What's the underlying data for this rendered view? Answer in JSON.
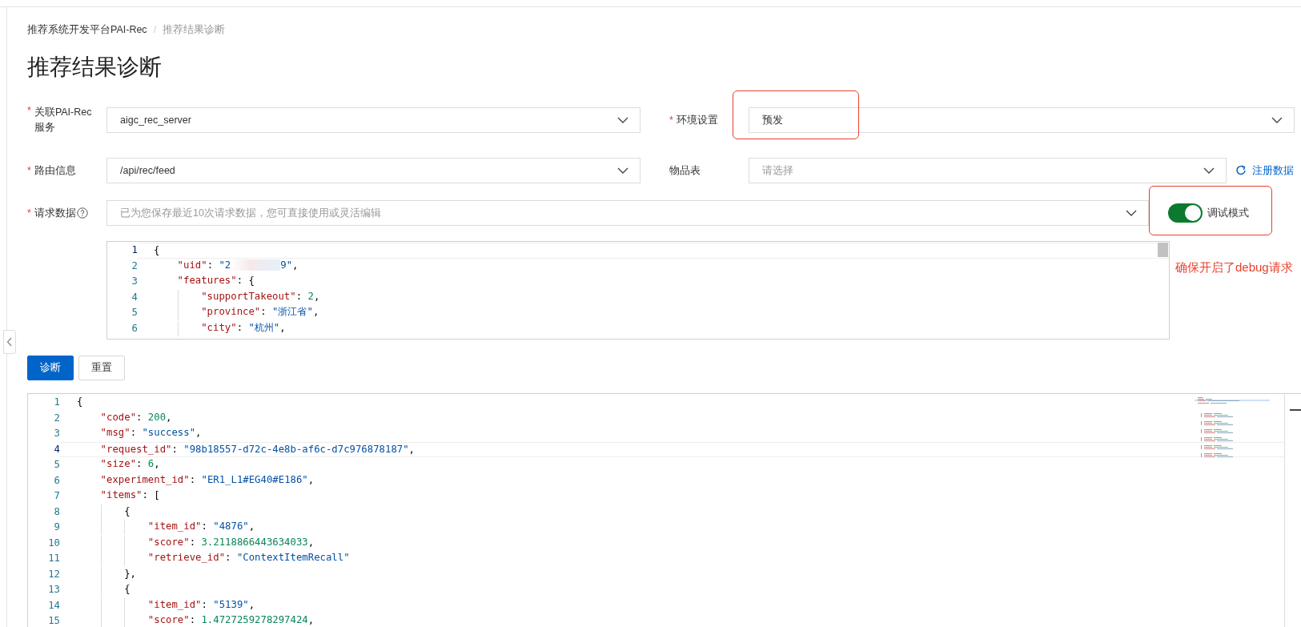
{
  "breadcrumb": [
    {
      "label": "推荐系统开发平台PAI-Rec",
      "current": false
    },
    {
      "label": "推荐结果诊断",
      "current": true
    }
  ],
  "breadcrumb_separator": "/",
  "title": "推荐结果诊断",
  "required_mark": "*",
  "form": {
    "service": {
      "label": "关联PAI-Rec服务",
      "required": true,
      "value": "aigc_rec_server"
    },
    "environment": {
      "label": "环境设置",
      "required": true,
      "value": "预发"
    },
    "route": {
      "label": "路由信息",
      "required": true,
      "value": "/api/rec/feed"
    },
    "item_table": {
      "label": "物品表",
      "required": false,
      "placeholder": "请选择",
      "link": "注册数据"
    },
    "request_data": {
      "label": "请求数据",
      "required": true,
      "placeholder": "已为您保存最近10次请求数据，您可直接使用或灵活编辑"
    },
    "debug_mode": {
      "label": "调试模式",
      "on": true
    }
  },
  "annotation": "确保开启了debug请求",
  "request_editor": {
    "lines": [
      {
        "n": "1",
        "current": true,
        "tokens": [
          {
            "kind": "punct",
            "text": "{"
          }
        ]
      },
      {
        "n": "2",
        "current": false,
        "tokens": [
          {
            "kind": "indent"
          },
          {
            "kind": "key",
            "text": "\"uid\""
          },
          {
            "kind": "punct",
            "text": ": "
          },
          {
            "kind": "str",
            "text": "\"2"
          },
          {
            "kind": "redacted"
          },
          {
            "kind": "str",
            "text": "9\""
          },
          {
            "kind": "punct",
            "text": ","
          }
        ]
      },
      {
        "n": "3",
        "current": false,
        "tokens": [
          {
            "kind": "indent"
          },
          {
            "kind": "key",
            "text": "\"features\""
          },
          {
            "kind": "punct",
            "text": ": {"
          }
        ]
      },
      {
        "n": "4",
        "current": false,
        "tokens": [
          {
            "kind": "indent"
          },
          {
            "kind": "indent"
          },
          {
            "kind": "key",
            "text": "\"supportTakeout\""
          },
          {
            "kind": "punct",
            "text": ": "
          },
          {
            "kind": "num",
            "text": "2"
          },
          {
            "kind": "punct",
            "text": ","
          }
        ]
      },
      {
        "n": "5",
        "current": false,
        "tokens": [
          {
            "kind": "indent"
          },
          {
            "kind": "indent"
          },
          {
            "kind": "key",
            "text": "\"province\""
          },
          {
            "kind": "punct",
            "text": ": "
          },
          {
            "kind": "str",
            "text": "\"浙江省\""
          },
          {
            "kind": "punct",
            "text": ","
          }
        ]
      },
      {
        "n": "6",
        "current": false,
        "tokens": [
          {
            "kind": "indent"
          },
          {
            "kind": "indent"
          },
          {
            "kind": "key",
            "text": "\"city\""
          },
          {
            "kind": "punct",
            "text": ": "
          },
          {
            "kind": "str",
            "text": "\"杭州\""
          },
          {
            "kind": "punct",
            "text": ","
          }
        ]
      }
    ]
  },
  "buttons": [
    {
      "label": "诊断",
      "kind": "primary"
    },
    {
      "label": "重置",
      "kind": "default"
    }
  ],
  "result_editor": {
    "lines": [
      {
        "n": "1",
        "current": false,
        "tokens": [
          {
            "kind": "punct",
            "text": "{"
          }
        ]
      },
      {
        "n": "2",
        "current": false,
        "tokens": [
          {
            "kind": "indent"
          },
          {
            "kind": "key",
            "text": "\"code\""
          },
          {
            "kind": "punct",
            "text": ": "
          },
          {
            "kind": "num",
            "text": "200"
          },
          {
            "kind": "punct",
            "text": ","
          }
        ]
      },
      {
        "n": "3",
        "current": false,
        "tokens": [
          {
            "kind": "indent"
          },
          {
            "kind": "key",
            "text": "\"msg\""
          },
          {
            "kind": "punct",
            "text": ": "
          },
          {
            "kind": "str",
            "text": "\"success\""
          },
          {
            "kind": "punct",
            "text": ","
          }
        ]
      },
      {
        "n": "4",
        "current": true,
        "tokens": [
          {
            "kind": "indent"
          },
          {
            "kind": "key",
            "text": "\"request_id\""
          },
          {
            "kind": "punct",
            "text": ": "
          },
          {
            "kind": "str",
            "text": "\"98b18557-d72c-4e8b-af6c-d7c976878187\""
          },
          {
            "kind": "punct",
            "text": ","
          }
        ]
      },
      {
        "n": "5",
        "current": false,
        "tokens": [
          {
            "kind": "indent"
          },
          {
            "kind": "key",
            "text": "\"size\""
          },
          {
            "kind": "punct",
            "text": ": "
          },
          {
            "kind": "num",
            "text": "6"
          },
          {
            "kind": "punct",
            "text": ","
          }
        ]
      },
      {
        "n": "6",
        "current": false,
        "tokens": [
          {
            "kind": "indent"
          },
          {
            "kind": "key",
            "text": "\"experiment_id\""
          },
          {
            "kind": "punct",
            "text": ": "
          },
          {
            "kind": "str",
            "text": "\"ER1_L1#EG40#E186\""
          },
          {
            "kind": "punct",
            "text": ","
          }
        ]
      },
      {
        "n": "7",
        "current": false,
        "tokens": [
          {
            "kind": "indent"
          },
          {
            "kind": "key",
            "text": "\"items\""
          },
          {
            "kind": "punct",
            "text": ": ["
          }
        ]
      },
      {
        "n": "8",
        "current": false,
        "tokens": [
          {
            "kind": "indent"
          },
          {
            "kind": "indent"
          },
          {
            "kind": "punct",
            "text": "{"
          }
        ]
      },
      {
        "n": "9",
        "current": false,
        "tokens": [
          {
            "kind": "indent"
          },
          {
            "kind": "indent"
          },
          {
            "kind": "indent"
          },
          {
            "kind": "key",
            "text": "\"item_id\""
          },
          {
            "kind": "punct",
            "text": ": "
          },
          {
            "kind": "str",
            "text": "\"4876\""
          },
          {
            "kind": "punct",
            "text": ","
          }
        ]
      },
      {
        "n": "10",
        "current": false,
        "tokens": [
          {
            "kind": "indent"
          },
          {
            "kind": "indent"
          },
          {
            "kind": "indent"
          },
          {
            "kind": "key",
            "text": "\"score\""
          },
          {
            "kind": "punct",
            "text": ": "
          },
          {
            "kind": "num",
            "text": "3.2118866443634033"
          },
          {
            "kind": "punct",
            "text": ","
          }
        ]
      },
      {
        "n": "11",
        "current": false,
        "tokens": [
          {
            "kind": "indent"
          },
          {
            "kind": "indent"
          },
          {
            "kind": "indent"
          },
          {
            "kind": "key",
            "text": "\"retrieve_id\""
          },
          {
            "kind": "punct",
            "text": ": "
          },
          {
            "kind": "str",
            "text": "\"ContextItemRecall\""
          }
        ]
      },
      {
        "n": "12",
        "current": false,
        "tokens": [
          {
            "kind": "indent"
          },
          {
            "kind": "indent"
          },
          {
            "kind": "punct",
            "text": "},"
          }
        ]
      },
      {
        "n": "13",
        "current": false,
        "tokens": [
          {
            "kind": "indent"
          },
          {
            "kind": "indent"
          },
          {
            "kind": "punct",
            "text": "{"
          }
        ]
      },
      {
        "n": "14",
        "current": false,
        "tokens": [
          {
            "kind": "indent"
          },
          {
            "kind": "indent"
          },
          {
            "kind": "indent"
          },
          {
            "kind": "key",
            "text": "\"item_id\""
          },
          {
            "kind": "punct",
            "text": ": "
          },
          {
            "kind": "str",
            "text": "\"5139\""
          },
          {
            "kind": "punct",
            "text": ","
          }
        ]
      },
      {
        "n": "15",
        "current": false,
        "tokens": [
          {
            "kind": "indent"
          },
          {
            "kind": "indent"
          },
          {
            "kind": "indent"
          },
          {
            "kind": "key",
            "text": "\"score\""
          },
          {
            "kind": "punct",
            "text": ": "
          },
          {
            "kind": "num",
            "text": "1.4727259278297424"
          },
          {
            "kind": "punct",
            "text": ","
          }
        ]
      }
    ]
  }
}
